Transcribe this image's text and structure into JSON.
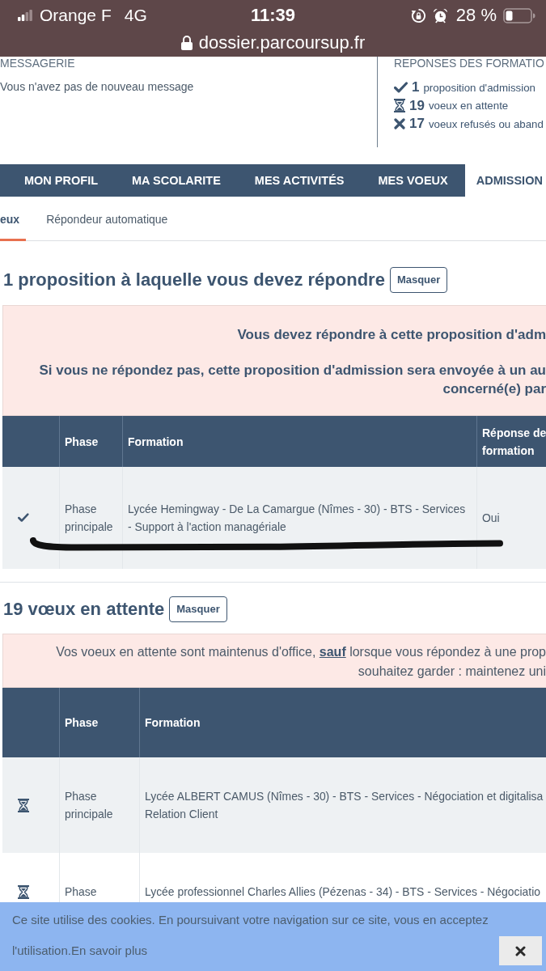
{
  "status_bar": {
    "carrier": "Orange F",
    "network": "4G",
    "time": "11:39",
    "battery": "28 %",
    "url": "dossier.parcoursup.fr"
  },
  "messages": {
    "title": "MESSAGERIE",
    "text": "Vous n'avez pas de nouveau message"
  },
  "responses": {
    "title": "REPONSES DES FORMATIO",
    "items": [
      {
        "kind": "accepted",
        "count": "1",
        "label": "proposition d'admission"
      },
      {
        "kind": "waiting",
        "count": "19",
        "label": "voeux en attente"
      },
      {
        "kind": "refused",
        "count": "17",
        "label": "voeux refusés ou aband"
      }
    ]
  },
  "nav": [
    {
      "label": "MON PROFIL",
      "selected": false
    },
    {
      "label": "MA SCOLARITE",
      "selected": false
    },
    {
      "label": "MES ACTIVITÉS",
      "selected": false
    },
    {
      "label": "MES VOEUX",
      "selected": false
    },
    {
      "label": "ADMISSION",
      "selected": true
    }
  ],
  "subtabs": [
    {
      "label": "eux",
      "selected": true
    },
    {
      "label": "Répondeur automatique",
      "selected": false
    }
  ],
  "sections": [
    {
      "heading": "1 proposition à laquelle vous devez répondre",
      "button": "Masquer",
      "alert": {
        "bold": true,
        "paragraphs": [
          "Vous devez répondre à cette proposition d'adm",
          "Si vous ne répondez pas, cette proposition d'admission sera envoyée à un au\nconcerné(e) par"
        ]
      },
      "table": {
        "columns": [
          "Phase",
          "Formation",
          "Réponse de\nformation"
        ],
        "rows": [
          {
            "kind": "accepted",
            "pen_mark": true,
            "cells": [
              "Phase principale",
              "Lycée Hemingway - De La Camargue (Nîmes - 30) - BTS - Services - Support à l'action managériale",
              "Oui"
            ]
          }
        ]
      }
    },
    {
      "heading": "19 vœux en attente",
      "button": "Masquer",
      "alert": {
        "bold": false,
        "paragraphs": [
          "Vos voeux en attente sont maintenus d'office, **sauf** lorsque vous répondez à une prop\nsouhaitez garder : maintenez uni"
        ]
      },
      "table": {
        "columns": [
          "Phase",
          "Formation"
        ],
        "rows": [
          {
            "kind": "waiting",
            "pen_mark": false,
            "cells": [
              "Phase principale",
              "Lycée ALBERT CAMUS (Nîmes - 30) - BTS - Services - Négociation et digitalisa\nRelation Client"
            ]
          },
          {
            "kind": "waiting",
            "pen_mark": false,
            "cells": [
              "Phase",
              "Lycée professionnel Charles Allies (Pézenas - 34) - BTS - Services - Négociatio"
            ]
          }
        ]
      }
    }
  ],
  "cookie_banner": {
    "text": "Ce site utilise des cookies. En poursuivant votre navigation sur ce site, vous en acceptez l'utilisation.",
    "link": "En savoir plus"
  }
}
